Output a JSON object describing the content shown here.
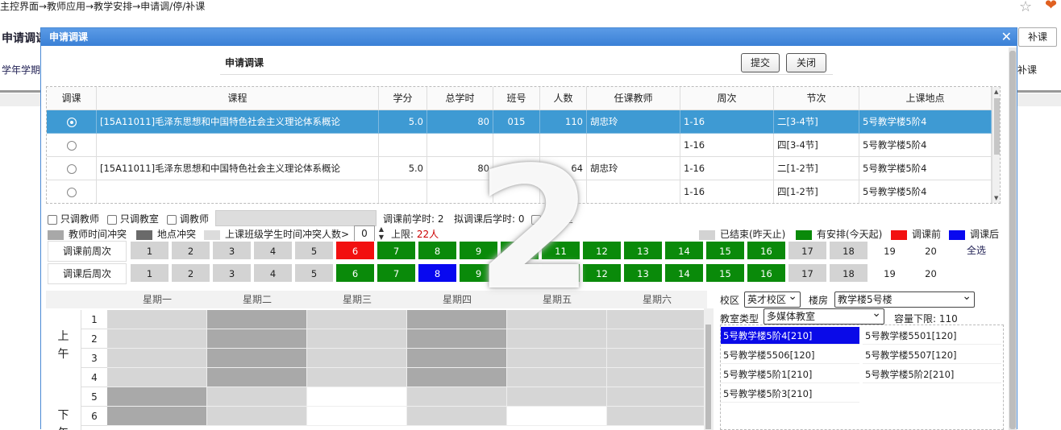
{
  "background": {
    "breadcrumb": "主控界面→教师应用→教学安排→申请调/停/补课",
    "page_title": "申请调课",
    "term_tab": "学年学期",
    "buke_button": "补课",
    "buke_tab": "补课"
  },
  "dialog": {
    "title": "申请调课",
    "form_title": "申请调课",
    "submit_label": "提交",
    "close_label": "关闭"
  },
  "course_table": {
    "headers": [
      "调课",
      "课程",
      "学分",
      "总学时",
      "班号",
      "人数",
      "任课教师",
      "周次",
      "节次",
      "上课地点"
    ],
    "rows": [
      {
        "course": "[15A11011]毛泽东思想和中国特色社会主义理论体系概论",
        "credit": "5.0",
        "hours": "80",
        "class_no": "015",
        "count": "110",
        "teacher": "胡忠玲",
        "weeks": "1-16",
        "periods": "二[3-4节]",
        "location": "5号教学楼5阶4"
      },
      {
        "course": "",
        "credit": "",
        "hours": "",
        "class_no": "",
        "count": "",
        "teacher": "",
        "weeks": "1-16",
        "periods": "四[3-4节]",
        "location": "5号教学楼5阶4"
      },
      {
        "course": "[15A11011]毛泽东思想和中国特色社会主义理论体系概论",
        "credit": "5.0",
        "hours": "80",
        "class_no": "",
        "count": "64",
        "teacher": "胡忠玲",
        "weeks": "1-16",
        "periods": "二[1-2节]",
        "location": "5号教学楼5阶4"
      },
      {
        "course": "",
        "credit": "",
        "hours": "",
        "class_no": "",
        "count": "",
        "teacher": "",
        "weeks": "1-16",
        "periods": "四[1-2节]",
        "location": "5号教学楼5阶4"
      }
    ]
  },
  "options": {
    "only_teacher": "只调教师",
    "only_room": "只调教室",
    "change_teacher": "调教师",
    "before_hours": "调课前学时: 2",
    "after_hours": "拟调课后学时: 0",
    "arrange_room": "排教室"
  },
  "legend": {
    "teacher_conflict": "教师时间冲突",
    "location_conflict": "地点冲突",
    "student_conflict": "上课班级学生时间冲突人数>",
    "conflict_value": "0",
    "upper_limit_label": "上限:",
    "upper_limit_value": "22人",
    "ended": "已结束(昨天止)",
    "arranged": "有安排(今天起)",
    "before": "调课前",
    "after": "调课后",
    "colors": {
      "ended": "#d3d3d3",
      "arranged": "#0a8a0a",
      "before": "#f21010",
      "after": "#0808f0"
    }
  },
  "weeks": {
    "before_label": "调课前周次",
    "after_label": "调课后周次",
    "numbers": [
      "1",
      "2",
      "3",
      "4",
      "5",
      "6",
      "7",
      "8",
      "9",
      "10",
      "11",
      "12",
      "13",
      "14",
      "15",
      "16",
      "17",
      "18",
      "19",
      "20"
    ],
    "before_states": [
      "ended",
      "ended",
      "ended",
      "ended",
      "ended",
      "before",
      "arranged",
      "arranged",
      "arranged",
      "arranged",
      "arranged",
      "arranged",
      "arranged",
      "arranged",
      "arranged",
      "arranged",
      "ended",
      "ended",
      "none",
      "none"
    ],
    "after_states": [
      "ended",
      "ended",
      "ended",
      "ended",
      "ended",
      "arranged",
      "arranged",
      "after",
      "arranged",
      "arranged",
      "arranged",
      "arranged",
      "arranged",
      "arranged",
      "arranged",
      "arranged",
      "ended",
      "ended",
      "none",
      "none"
    ],
    "select_all": "全选"
  },
  "schedule": {
    "days": [
      "星期一",
      "星期二",
      "星期三",
      "星期四",
      "星期五",
      "星期六"
    ],
    "morning": "上午",
    "afternoon": "下午",
    "periods": [
      "1",
      "2",
      "3",
      "4",
      "5",
      "6"
    ]
  },
  "room_panel": {
    "campus_label": "校区",
    "campus_value": "英才校区",
    "building_label": "楼房",
    "building_value": "教学楼5号楼",
    "type_label": "教室类型",
    "type_value": "多媒体教室",
    "capacity": "容量下限: 110",
    "rooms": [
      "5号教学楼5阶4[210]",
      "5号教学楼5501[120]",
      "5号教学楼5506[120]",
      "5号教学楼5507[120]",
      "5号教学楼5阶1[210]",
      "5号教学楼5阶2[210]",
      "5号教学楼5阶3[210]"
    ]
  },
  "watermark": "2"
}
